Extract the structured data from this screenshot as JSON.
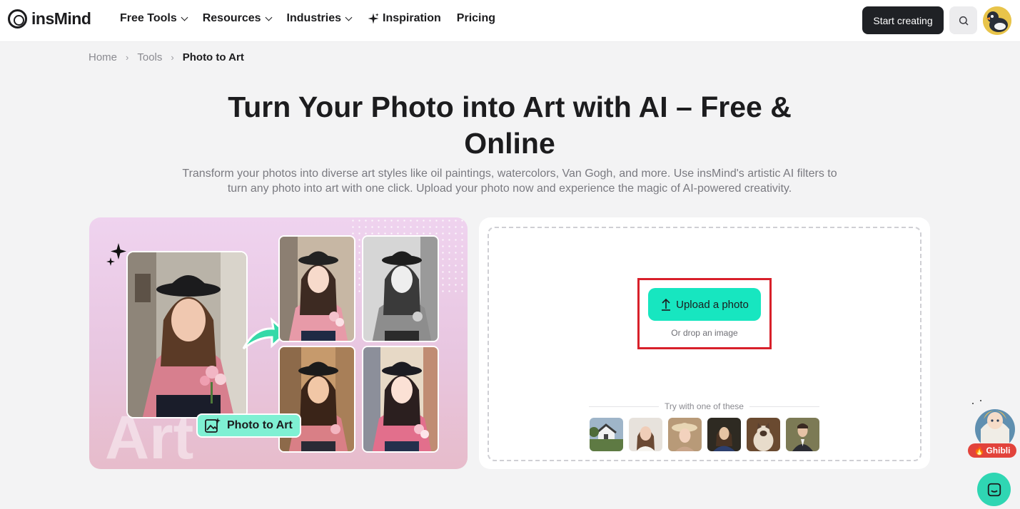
{
  "header": {
    "logo_text": "insMind",
    "nav": [
      {
        "label": "Free Tools",
        "has_dropdown": true
      },
      {
        "label": "Resources",
        "has_dropdown": true
      },
      {
        "label": "Industries",
        "has_dropdown": true
      },
      {
        "label": "Inspiration",
        "has_dropdown": false,
        "icon": "sparkle-icon"
      },
      {
        "label": "Pricing",
        "has_dropdown": false
      }
    ],
    "start_button": "Start creating"
  },
  "breadcrumb": {
    "items": [
      "Home",
      "Tools"
    ],
    "current": "Photo to Art"
  },
  "hero": {
    "title": "Turn Your Photo into Art with AI – Free & Online",
    "subtitle": "Transform your photos into diverse art styles like oil paintings, watercolors, Van Gogh, and more. Use insMind's artistic AI filters to turn any photo into art with one click. Upload your photo now and experience the magic of AI-powered creativity."
  },
  "showcase": {
    "tag_label": "Photo to Art",
    "bg_word": "Art"
  },
  "upload": {
    "button_label": "Upload a photo",
    "drop_hint": "Or drop an image",
    "try_label": "Try with one of these",
    "samples": [
      "house",
      "woman-portrait",
      "girl-hat",
      "painting-woman",
      "cat",
      "man-suit"
    ]
  },
  "floating": {
    "ghibli_label": "Ghibli"
  },
  "colors": {
    "accent": "#17e6c0",
    "highlight_border": "#d8202a",
    "dark_button": "#1f2125"
  }
}
